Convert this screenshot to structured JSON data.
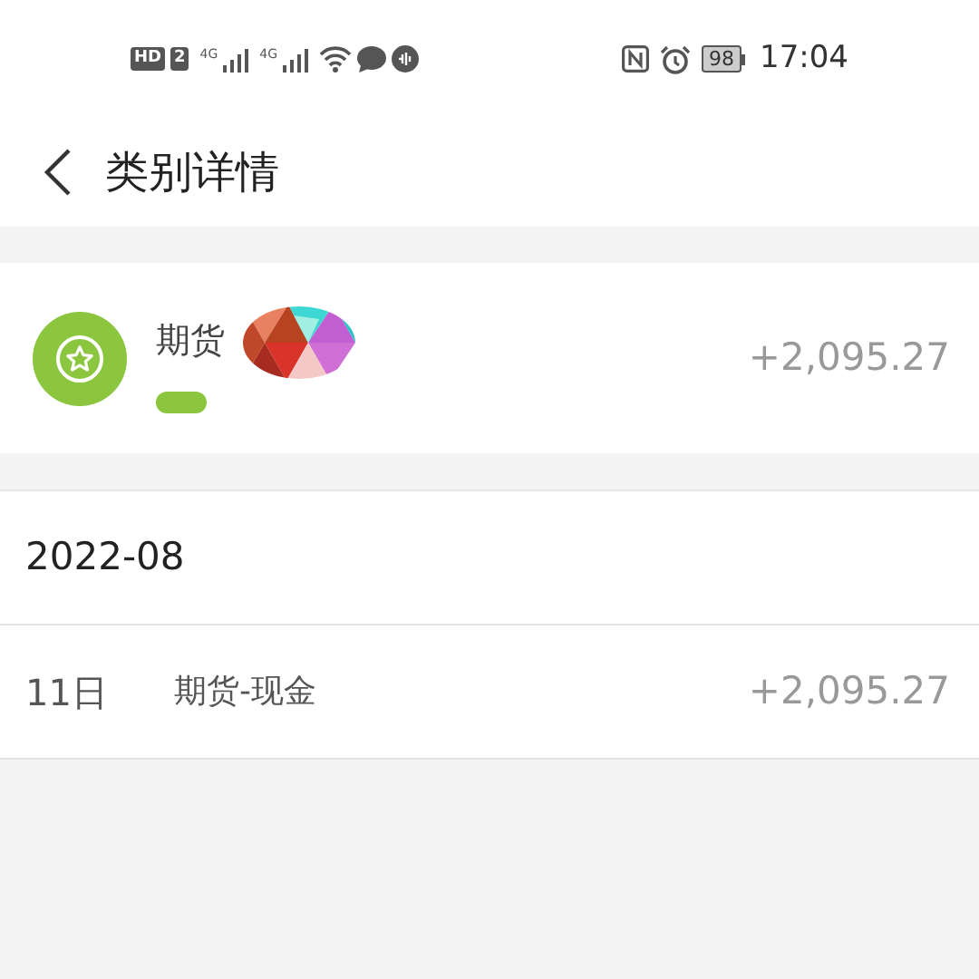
{
  "status_bar": {
    "left_badges": [
      "HD",
      "2"
    ],
    "networks": [
      "4G",
      "4G"
    ],
    "battery": "98",
    "time": "17:04"
  },
  "header": {
    "title": "类别详情"
  },
  "category": {
    "name": "期货",
    "color": "#8cc63f",
    "amount": "+2,095.27"
  },
  "months": [
    {
      "month": "2022-08",
      "entries": [
        {
          "day": "11日",
          "label": "期货-现金",
          "amount": "+2,095.27"
        }
      ]
    }
  ]
}
